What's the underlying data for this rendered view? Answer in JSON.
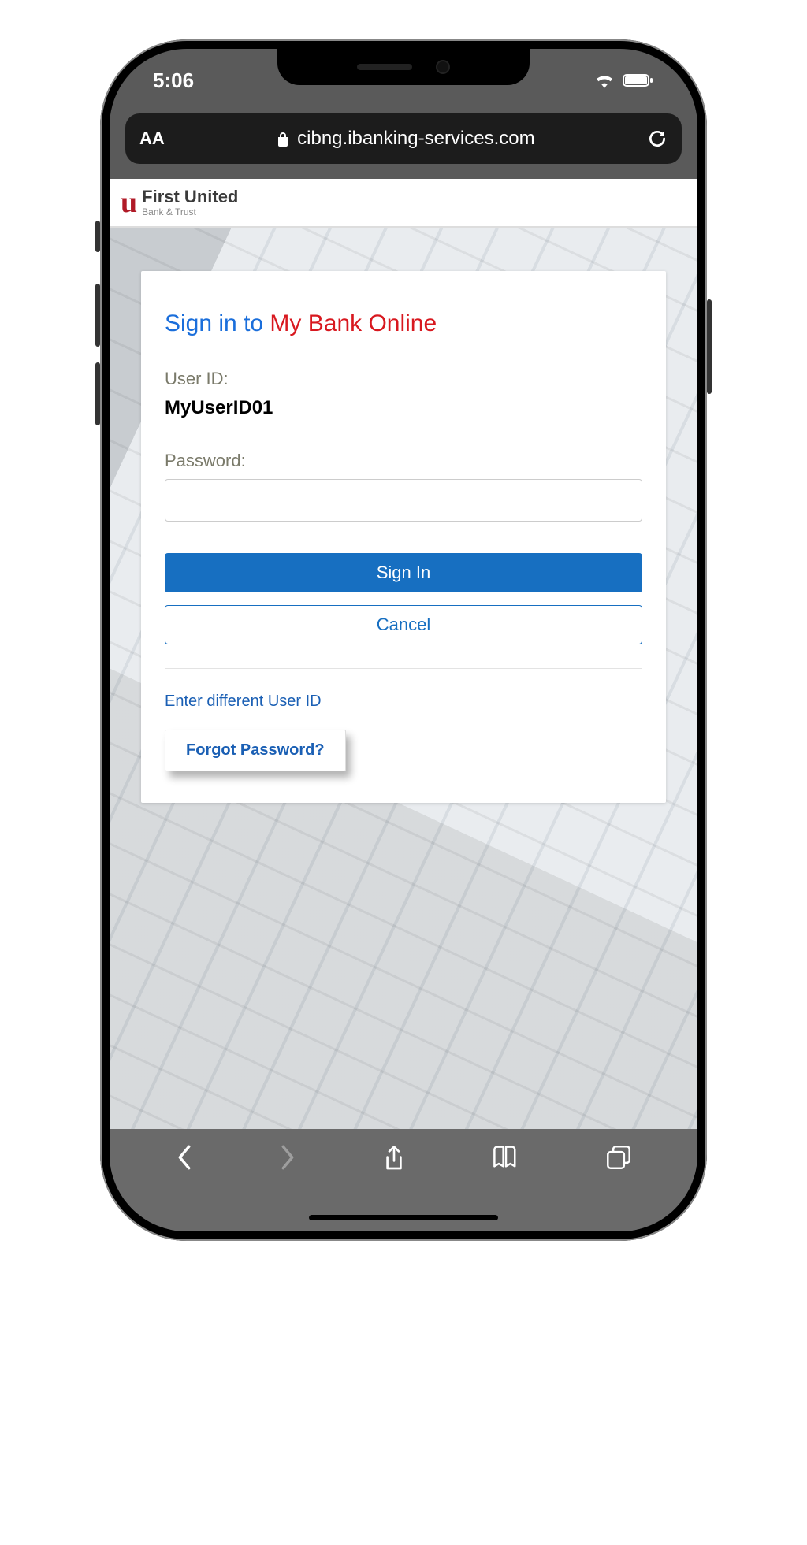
{
  "status": {
    "time": "5:06"
  },
  "urlbar": {
    "aa": "AA",
    "url": "cibng.ibanking-services.com"
  },
  "site": {
    "brand_primary": "First United",
    "brand_secondary": "Bank & Trust"
  },
  "signin": {
    "heading_prefix": "Sign in to ",
    "heading_brand": "My Bank Online",
    "user_label": "User ID:",
    "user_value": "MyUserID01",
    "password_label": "Password:",
    "signin_button": "Sign In",
    "cancel_button": "Cancel",
    "different_user": "Enter different User ID",
    "forgot_password": "Forgot Password?"
  }
}
